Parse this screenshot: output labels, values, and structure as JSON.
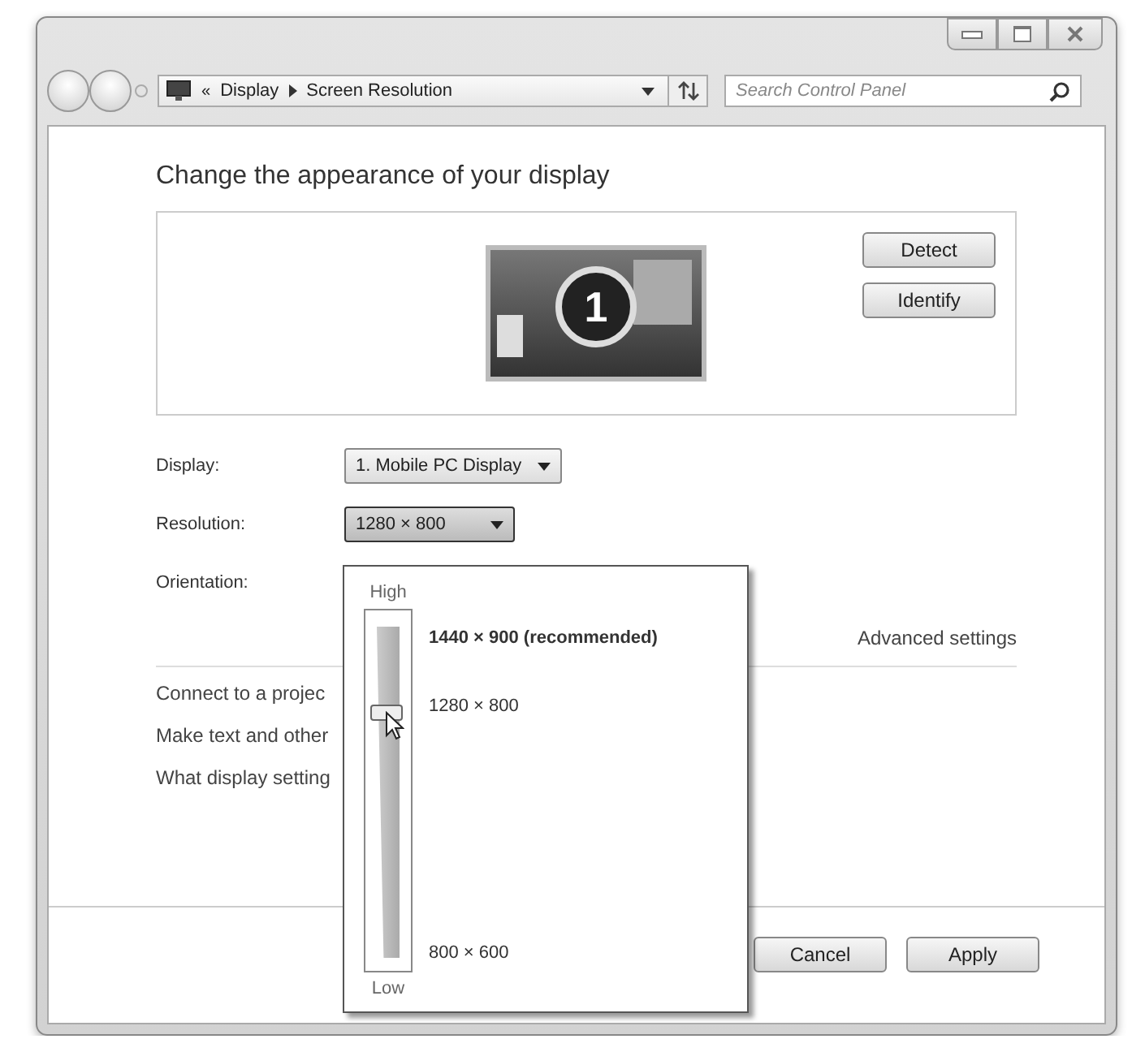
{
  "address_bar": {
    "breadcrumb_prefix": "«",
    "crumbs": [
      "Display",
      "Screen Resolution"
    ]
  },
  "search": {
    "placeholder": "Search Control Panel"
  },
  "heading": "Change the appearance of your display",
  "monitor": {
    "number": "1"
  },
  "monitor_buttons": [
    "Detect",
    "Identify"
  ],
  "settings": [
    {
      "label": "Display:",
      "value": "1. Mobile PC Display",
      "open": false
    },
    {
      "label": "Resolution:",
      "value": "1280 × 800",
      "open": true
    },
    {
      "label": "Orientation:"
    }
  ],
  "advanced_link": "Advanced settings",
  "links": [
    "Connect to a projec",
    "Make text and other",
    "What display setting"
  ],
  "footer_buttons": [
    "Cancel",
    "Apply"
  ],
  "resolution_popup": {
    "high_label": "High",
    "low_label": "Low",
    "level": 0.71,
    "options": [
      {
        "label": "1440 × 900 (recommended)",
        "recommended": true
      },
      {
        "label": "1280 × 800",
        "recommended": false
      },
      {
        "label": "800 × 600",
        "recommended": false
      }
    ]
  }
}
